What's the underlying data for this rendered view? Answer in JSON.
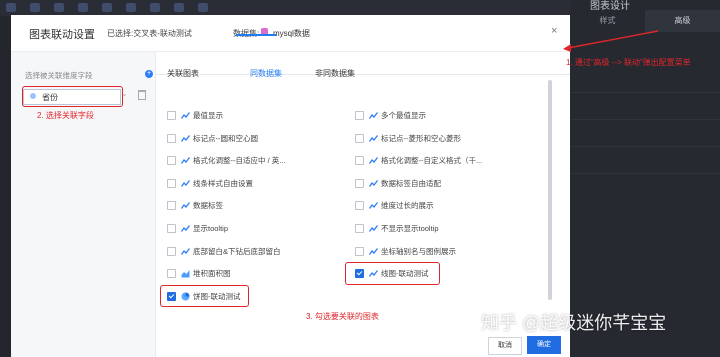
{
  "background": {
    "panel_title": "图表设计",
    "tabs": [
      {
        "label": "样式"
      },
      {
        "label": "高级"
      }
    ]
  },
  "modal": {
    "title": "图表联动设置",
    "selected_label": "已选择:交叉表-联动测试",
    "dataset_label": "数据集:",
    "dataset_name": "mysql数据",
    "close": "×",
    "left_panel": {
      "heading": "选择被关联维度字段",
      "add": "+",
      "field": "省份"
    },
    "tabs": [
      {
        "label": "关联图表"
      },
      {
        "label": "同数据集",
        "active": true
      },
      {
        "label": "非同数据集"
      }
    ],
    "items_left": [
      {
        "label": "最值显示",
        "checked": false,
        "icon": "line-chart-icon"
      },
      {
        "label": "标记点--圆和空心圆",
        "checked": false,
        "icon": "line-chart-icon"
      },
      {
        "label": "格式化调整--自适应中 / 英...",
        "checked": false,
        "icon": "line-chart-icon"
      },
      {
        "label": "线条样式自由设置",
        "checked": false,
        "icon": "line-chart-icon"
      },
      {
        "label": "数据标签",
        "checked": false,
        "icon": "line-chart-icon"
      },
      {
        "label": "显示tooltip",
        "checked": false,
        "icon": "line-chart-icon"
      },
      {
        "label": "底部留白&下钻后底部留白",
        "checked": false,
        "icon": "line-chart-icon"
      },
      {
        "label": "堆积面积图",
        "checked": false,
        "icon": "area-chart-icon"
      },
      {
        "label": "饼图-联动测试",
        "checked": true,
        "icon": "pie-chart-icon"
      }
    ],
    "items_right": [
      {
        "label": "多个最值显示",
        "checked": false,
        "icon": "line-chart-icon"
      },
      {
        "label": "标记点--菱形和空心菱形",
        "checked": false,
        "icon": "line-chart-icon"
      },
      {
        "label": "格式化调整--自定义格式（千...",
        "checked": false,
        "icon": "line-chart-icon"
      },
      {
        "label": "数据标签自由适配",
        "checked": false,
        "icon": "line-chart-icon"
      },
      {
        "label": "维度过长的展示",
        "checked": false,
        "icon": "line-chart-icon"
      },
      {
        "label": "不显示显示tooltip",
        "checked": false,
        "icon": "line-chart-icon"
      },
      {
        "label": "坐标轴别名与图例展示",
        "checked": false,
        "icon": "line-chart-icon"
      },
      {
        "label": "线图-联动测试",
        "checked": true,
        "icon": "line-chart-icon"
      }
    ],
    "footer": {
      "cancel": "取消",
      "ok": "确定"
    }
  },
  "annotations": {
    "note1": "1. 通过“高级 --> 联动”弹出配置菜单",
    "note2": "2. 选择关联字段",
    "note3": "3. 勾选要关联的图表"
  },
  "watermark": "知乎 @超级迷你芊宝宝",
  "colors": {
    "primary": "#1f6de0",
    "annotation": "#e0262b"
  }
}
